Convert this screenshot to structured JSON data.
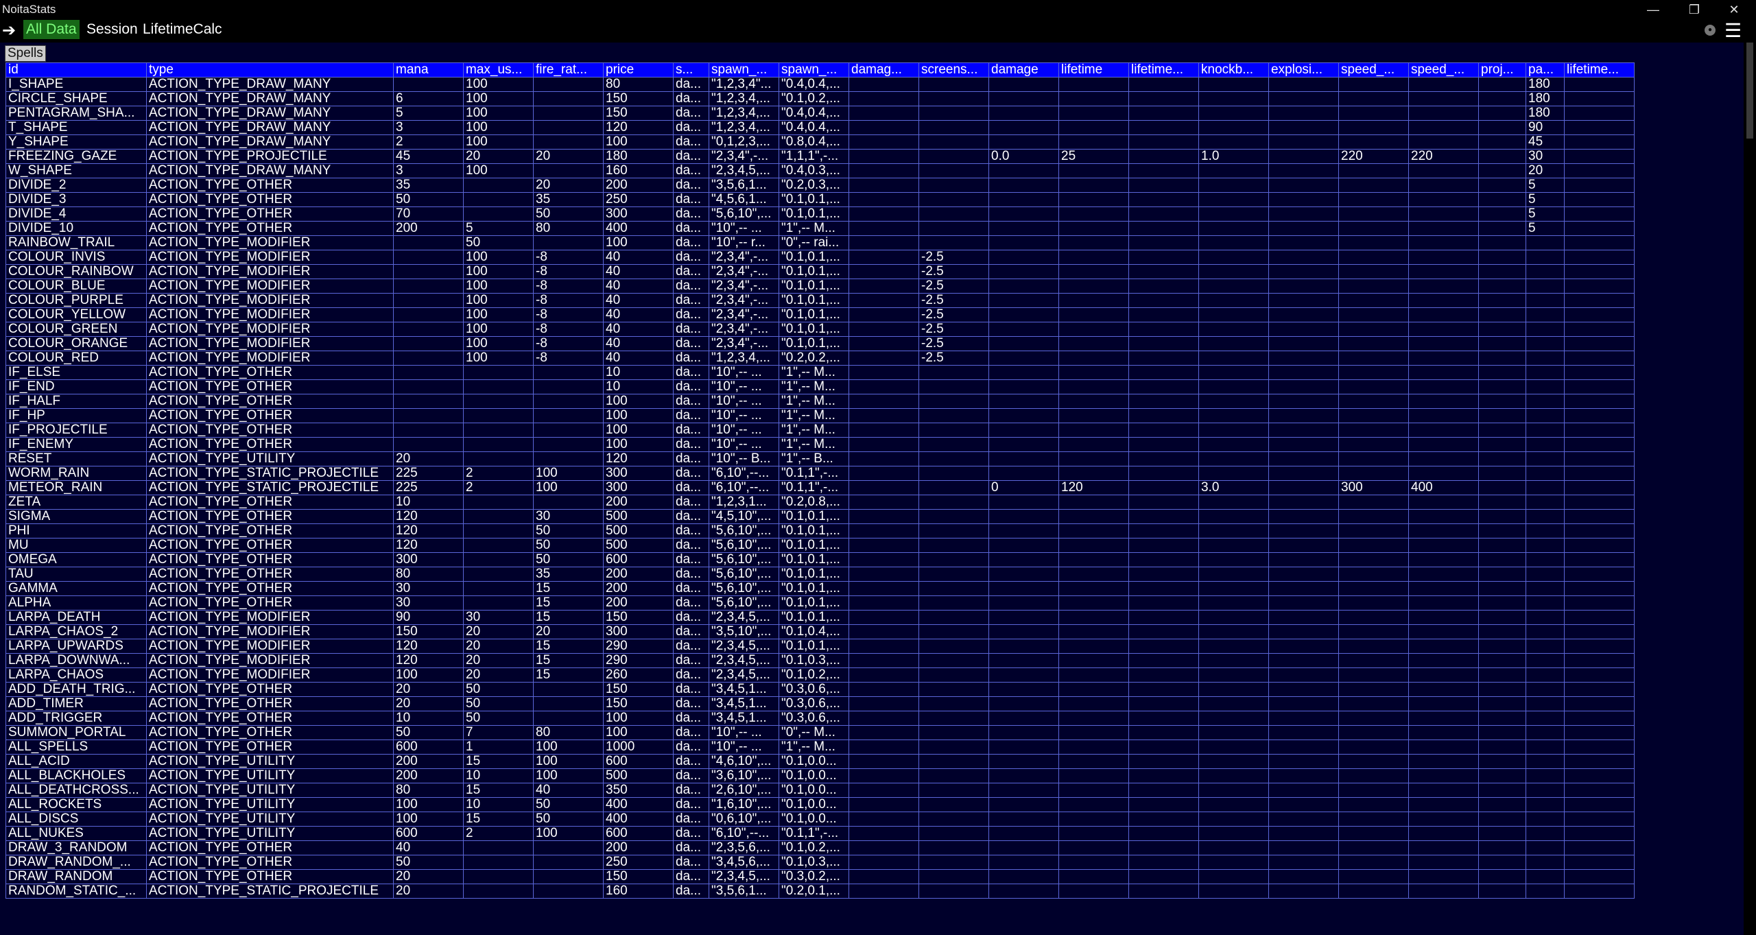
{
  "window": {
    "title": "NoitaStats"
  },
  "toolbar": {
    "tab_all": "All Data",
    "tab_session": "Session",
    "tab_lifetime": "LifetimeCalc"
  },
  "table_title": "Spells",
  "columns": [
    "id",
    "type",
    "mana",
    "max_us...",
    "fire_rat...",
    "price",
    "s...",
    "spawn_...",
    "spawn_...",
    "damag...",
    "screens...",
    "damage",
    "lifetime",
    "lifetime...",
    "knockb...",
    "explosi...",
    "speed_...",
    "speed_...",
    "proj...",
    "pa...",
    "lifetime..."
  ],
  "rows": [
    [
      "I_SHAPE",
      "ACTION_TYPE_DRAW_MANY",
      "",
      "100",
      "",
      "80",
      "da...",
      "\"1,2,3,4\"...",
      "\"0.4,0.4,...",
      "",
      "",
      "",
      "",
      "",
      "",
      "",
      "",
      "",
      "",
      "180",
      ""
    ],
    [
      "CIRCLE_SHAPE",
      "ACTION_TYPE_DRAW_MANY",
      "6",
      "100",
      "",
      "150",
      "da...",
      "\"1,2,3,4,...",
      "\"0.1,0.2,...",
      "",
      "",
      "",
      "",
      "",
      "",
      "",
      "",
      "",
      "",
      "180",
      ""
    ],
    [
      "PENTAGRAM_SHA...",
      "ACTION_TYPE_DRAW_MANY",
      "5",
      "100",
      "",
      "150",
      "da...",
      "\"1,2,3,4,...",
      "\"0.4,0.4,...",
      "",
      "",
      "",
      "",
      "",
      "",
      "",
      "",
      "",
      "",
      "180",
      ""
    ],
    [
      "T_SHAPE",
      "ACTION_TYPE_DRAW_MANY",
      "3",
      "100",
      "",
      "120",
      "da...",
      "\"1,2,3,4,...",
      "\"0.4,0.4,...",
      "",
      "",
      "",
      "",
      "",
      "",
      "",
      "",
      "",
      "",
      "90",
      ""
    ],
    [
      "Y_SHAPE",
      "ACTION_TYPE_DRAW_MANY",
      "2",
      "100",
      "",
      "100",
      "da...",
      "\"0,1,2,3,...",
      "\"0.8,0.4,...",
      "",
      "",
      "",
      "",
      "",
      "",
      "",
      "",
      "",
      "",
      "45",
      ""
    ],
    [
      "FREEZING_GAZE",
      "ACTION_TYPE_PROJECTILE",
      "45",
      "20",
      "20",
      "180",
      "da...",
      "\"2,3,4\",-...",
      "\"1,1,1\",-...",
      "",
      "",
      "0.0",
      "25",
      "",
      "1.0",
      "",
      "220",
      "220",
      "",
      "30",
      ""
    ],
    [
      "W_SHAPE",
      "ACTION_TYPE_DRAW_MANY",
      "3",
      "100",
      "",
      "160",
      "da...",
      "\"2,3,4,5,...",
      "\"0.4,0.3,...",
      "",
      "",
      "",
      "",
      "",
      "",
      "",
      "",
      "",
      "",
      "20",
      ""
    ],
    [
      "DIVIDE_2",
      "ACTION_TYPE_OTHER",
      "35",
      "",
      "20",
      "200",
      "da...",
      "\"3,5,6,1...",
      "\"0.2,0.3,...",
      "",
      "",
      "",
      "",
      "",
      "",
      "",
      "",
      "",
      "",
      "5",
      ""
    ],
    [
      "DIVIDE_3",
      "ACTION_TYPE_OTHER",
      "50",
      "",
      "35",
      "250",
      "da...",
      "\"4,5,6,1...",
      "\"0.1,0.1,...",
      "",
      "",
      "",
      "",
      "",
      "",
      "",
      "",
      "",
      "",
      "5",
      ""
    ],
    [
      "DIVIDE_4",
      "ACTION_TYPE_OTHER",
      "70",
      "",
      "50",
      "300",
      "da...",
      "\"5,6,10\",...",
      "\"0.1,0.1,...",
      "",
      "",
      "",
      "",
      "",
      "",
      "",
      "",
      "",
      "",
      "5",
      ""
    ],
    [
      "DIVIDE_10",
      "ACTION_TYPE_OTHER",
      "200",
      "5",
      "80",
      "400",
      "da...",
      "\"10\",-- ...",
      "\"1\",-- M...",
      "",
      "",
      "",
      "",
      "",
      "",
      "",
      "",
      "",
      "",
      "5",
      ""
    ],
    [
      "RAINBOW_TRAIL",
      "ACTION_TYPE_MODIFIER",
      "",
      "50",
      "",
      "100",
      "da...",
      "\"10\",-- r...",
      "\"0\",-- rai...",
      "",
      "",
      "",
      "",
      "",
      "",
      "",
      "",
      "",
      "",
      "",
      ""
    ],
    [
      "COLOUR_INVIS",
      "ACTION_TYPE_MODIFIER",
      "",
      "100",
      "-8",
      "40",
      "da...",
      "\"2,3,4\",-...",
      "\"0.1,0.1,...",
      "",
      "-2.5",
      "",
      "",
      "",
      "",
      "",
      "",
      "",
      "",
      "",
      ""
    ],
    [
      "COLOUR_RAINBOW",
      "ACTION_TYPE_MODIFIER",
      "",
      "100",
      "-8",
      "40",
      "da...",
      "\"2,3,4\",-...",
      "\"0.1,0.1,...",
      "",
      "-2.5",
      "",
      "",
      "",
      "",
      "",
      "",
      "",
      "",
      "",
      ""
    ],
    [
      "COLOUR_BLUE",
      "ACTION_TYPE_MODIFIER",
      "",
      "100",
      "-8",
      "40",
      "da...",
      "\"2,3,4\",-...",
      "\"0.1,0.1,...",
      "",
      "-2.5",
      "",
      "",
      "",
      "",
      "",
      "",
      "",
      "",
      "",
      ""
    ],
    [
      "COLOUR_PURPLE",
      "ACTION_TYPE_MODIFIER",
      "",
      "100",
      "-8",
      "40",
      "da...",
      "\"2,3,4\",-...",
      "\"0.1,0.1,...",
      "",
      "-2.5",
      "",
      "",
      "",
      "",
      "",
      "",
      "",
      "",
      "",
      ""
    ],
    [
      "COLOUR_YELLOW",
      "ACTION_TYPE_MODIFIER",
      "",
      "100",
      "-8",
      "40",
      "da...",
      "\"2,3,4\",-...",
      "\"0.1,0.1,...",
      "",
      "-2.5",
      "",
      "",
      "",
      "",
      "",
      "",
      "",
      "",
      "",
      ""
    ],
    [
      "COLOUR_GREEN",
      "ACTION_TYPE_MODIFIER",
      "",
      "100",
      "-8",
      "40",
      "da...",
      "\"2,3,4\",-...",
      "\"0.1,0.1,...",
      "",
      "-2.5",
      "",
      "",
      "",
      "",
      "",
      "",
      "",
      "",
      "",
      ""
    ],
    [
      "COLOUR_ORANGE",
      "ACTION_TYPE_MODIFIER",
      "",
      "100",
      "-8",
      "40",
      "da...",
      "\"2,3,4\",-...",
      "\"0.1,0.1,...",
      "",
      "-2.5",
      "",
      "",
      "",
      "",
      "",
      "",
      "",
      "",
      "",
      ""
    ],
    [
      "COLOUR_RED",
      "ACTION_TYPE_MODIFIER",
      "",
      "100",
      "-8",
      "40",
      "da...",
      "\"1,2,3,4,...",
      "\"0.2,0.2,...",
      "",
      "-2.5",
      "",
      "",
      "",
      "",
      "",
      "",
      "",
      "",
      "",
      ""
    ],
    [
      "IF_ELSE",
      "ACTION_TYPE_OTHER",
      "",
      "",
      "",
      "10",
      "da...",
      "\"10\",-- ...",
      "\"1\",-- M...",
      "",
      "",
      "",
      "",
      "",
      "",
      "",
      "",
      "",
      "",
      "",
      ""
    ],
    [
      "IF_END",
      "ACTION_TYPE_OTHER",
      "",
      "",
      "",
      "10",
      "da...",
      "\"10\",-- ...",
      "\"1\",-- M...",
      "",
      "",
      "",
      "",
      "",
      "",
      "",
      "",
      "",
      "",
      "",
      ""
    ],
    [
      "IF_HALF",
      "ACTION_TYPE_OTHER",
      "",
      "",
      "",
      "100",
      "da...",
      "\"10\",-- ...",
      "\"1\",-- M...",
      "",
      "",
      "",
      "",
      "",
      "",
      "",
      "",
      "",
      "",
      "",
      ""
    ],
    [
      "IF_HP",
      "ACTION_TYPE_OTHER",
      "",
      "",
      "",
      "100",
      "da...",
      "\"10\",-- ...",
      "\"1\",-- M...",
      "",
      "",
      "",
      "",
      "",
      "",
      "",
      "",
      "",
      "",
      "",
      ""
    ],
    [
      "IF_PROJECTILE",
      "ACTION_TYPE_OTHER",
      "",
      "",
      "",
      "100",
      "da...",
      "\"10\",-- ...",
      "\"1\",-- M...",
      "",
      "",
      "",
      "",
      "",
      "",
      "",
      "",
      "",
      "",
      "",
      ""
    ],
    [
      "IF_ENEMY",
      "ACTION_TYPE_OTHER",
      "",
      "",
      "",
      "100",
      "da...",
      "\"10\",-- ...",
      "\"1\",-- M...",
      "",
      "",
      "",
      "",
      "",
      "",
      "",
      "",
      "",
      "",
      "",
      ""
    ],
    [
      "RESET",
      "ACTION_TYPE_UTILITY",
      "20",
      "",
      "",
      "120",
      "da...",
      "\"10\",-- B...",
      "\"1\",-- B...",
      "",
      "",
      "",
      "",
      "",
      "",
      "",
      "",
      "",
      "",
      "",
      ""
    ],
    [
      "WORM_RAIN",
      "ACTION_TYPE_STATIC_PROJECTILE",
      "225",
      "2",
      "100",
      "300",
      "da...",
      "\"6,10\",--...",
      "\"0.1,1\",-...",
      "",
      "",
      "",
      "",
      "",
      "",
      "",
      "",
      "",
      "",
      "",
      ""
    ],
    [
      "METEOR_RAIN",
      "ACTION_TYPE_STATIC_PROJECTILE",
      "225",
      "2",
      "100",
      "300",
      "da...",
      "\"6,10\",--...",
      "\"0.1,1\",-...",
      "",
      "",
      "0",
      "120",
      "",
      "3.0",
      "",
      "300",
      "400",
      "",
      "",
      ""
    ],
    [
      "ZETA",
      "ACTION_TYPE_OTHER",
      "10",
      "",
      "",
      "200",
      "da...",
      "\"1,2,3,1...",
      "\"0.2,0.8,...",
      "",
      "",
      "",
      "",
      "",
      "",
      "",
      "",
      "",
      "",
      "",
      ""
    ],
    [
      "SIGMA",
      "ACTION_TYPE_OTHER",
      "120",
      "",
      "30",
      "500",
      "da...",
      "\"4,5,10\",...",
      "\"0.1,0.1,...",
      "",
      "",
      "",
      "",
      "",
      "",
      "",
      "",
      "",
      "",
      "",
      ""
    ],
    [
      "PHI",
      "ACTION_TYPE_OTHER",
      "120",
      "",
      "50",
      "500",
      "da...",
      "\"5,6,10\",...",
      "\"0.1,0.1,...",
      "",
      "",
      "",
      "",
      "",
      "",
      "",
      "",
      "",
      "",
      "",
      ""
    ],
    [
      "MU",
      "ACTION_TYPE_OTHER",
      "120",
      "",
      "50",
      "500",
      "da...",
      "\"5,6,10\",...",
      "\"0.1,0.1,...",
      "",
      "",
      "",
      "",
      "",
      "",
      "",
      "",
      "",
      "",
      "",
      ""
    ],
    [
      "OMEGA",
      "ACTION_TYPE_OTHER",
      "300",
      "",
      "50",
      "600",
      "da...",
      "\"5,6,10\",...",
      "\"0.1,0.1,...",
      "",
      "",
      "",
      "",
      "",
      "",
      "",
      "",
      "",
      "",
      "",
      ""
    ],
    [
      "TAU",
      "ACTION_TYPE_OTHER",
      "80",
      "",
      "35",
      "200",
      "da...",
      "\"5,6,10\",...",
      "\"0.1,0.1,...",
      "",
      "",
      "",
      "",
      "",
      "",
      "",
      "",
      "",
      "",
      "",
      ""
    ],
    [
      "GAMMA",
      "ACTION_TYPE_OTHER",
      "30",
      "",
      "15",
      "200",
      "da...",
      "\"5,6,10\",...",
      "\"0.1,0.1,...",
      "",
      "",
      "",
      "",
      "",
      "",
      "",
      "",
      "",
      "",
      "",
      ""
    ],
    [
      "ALPHA",
      "ACTION_TYPE_OTHER",
      "30",
      "",
      "15",
      "200",
      "da...",
      "\"5,6,10\",...",
      "\"0.1,0.1,...",
      "",
      "",
      "",
      "",
      "",
      "",
      "",
      "",
      "",
      "",
      "",
      ""
    ],
    [
      "LARPA_DEATH",
      "ACTION_TYPE_MODIFIER",
      "90",
      "30",
      "15",
      "150",
      "da...",
      "\"2,3,4,5,...",
      "\"0.1,0.1,...",
      "",
      "",
      "",
      "",
      "",
      "",
      "",
      "",
      "",
      "",
      "",
      ""
    ],
    [
      "LARPA_CHAOS_2",
      "ACTION_TYPE_MODIFIER",
      "150",
      "20",
      "20",
      "300",
      "da...",
      "\"3,5,10\",...",
      "\"0.1,0.4,...",
      "",
      "",
      "",
      "",
      "",
      "",
      "",
      "",
      "",
      "",
      "",
      ""
    ],
    [
      "LARPA_UPWARDS",
      "ACTION_TYPE_MODIFIER",
      "120",
      "20",
      "15",
      "290",
      "da...",
      "\"2,3,4,5,...",
      "\"0.1,0.1,...",
      "",
      "",
      "",
      "",
      "",
      "",
      "",
      "",
      "",
      "",
      "",
      ""
    ],
    [
      "LARPA_DOWNWA...",
      "ACTION_TYPE_MODIFIER",
      "120",
      "20",
      "15",
      "290",
      "da...",
      "\"2,3,4,5,...",
      "\"0.1,0.3,...",
      "",
      "",
      "",
      "",
      "",
      "",
      "",
      "",
      "",
      "",
      "",
      ""
    ],
    [
      "LARPA_CHAOS",
      "ACTION_TYPE_MODIFIER",
      "100",
      "20",
      "15",
      "260",
      "da...",
      "\"2,3,4,5,...",
      "\"0.1,0.2,...",
      "",
      "",
      "",
      "",
      "",
      "",
      "",
      "",
      "",
      "",
      "",
      ""
    ],
    [
      "ADD_DEATH_TRIG...",
      "ACTION_TYPE_OTHER",
      "20",
      "50",
      "",
      "150",
      "da...",
      "\"3,4,5,1...",
      "\"0.3,0.6,...",
      "",
      "",
      "",
      "",
      "",
      "",
      "",
      "",
      "",
      "",
      "",
      ""
    ],
    [
      "ADD_TIMER",
      "ACTION_TYPE_OTHER",
      "20",
      "50",
      "",
      "150",
      "da...",
      "\"3,4,5,1...",
      "\"0.3,0.6,...",
      "",
      "",
      "",
      "",
      "",
      "",
      "",
      "",
      "",
      "",
      "",
      ""
    ],
    [
      "ADD_TRIGGER",
      "ACTION_TYPE_OTHER",
      "10",
      "50",
      "",
      "100",
      "da...",
      "\"3,4,5,1...",
      "\"0.3,0.6,...",
      "",
      "",
      "",
      "",
      "",
      "",
      "",
      "",
      "",
      "",
      "",
      ""
    ],
    [
      "SUMMON_PORTAL",
      "ACTION_TYPE_OTHER",
      "50",
      "7",
      "80",
      "100",
      "da...",
      "\"10\",-- ...",
      "\"0\",-- M...",
      "",
      "",
      "",
      "",
      "",
      "",
      "",
      "",
      "",
      "",
      "",
      ""
    ],
    [
      "ALL_SPELLS",
      "ACTION_TYPE_OTHER",
      "600",
      "1",
      "100",
      "1000",
      "da...",
      "\"10\",-- ...",
      "\"1\",-- M...",
      "",
      "",
      "",
      "",
      "",
      "",
      "",
      "",
      "",
      "",
      "",
      ""
    ],
    [
      "ALL_ACID",
      "ACTION_TYPE_UTILITY",
      "200",
      "15",
      "100",
      "600",
      "da...",
      "\"4,6,10\",...",
      "\"0.1,0.0...",
      "",
      "",
      "",
      "",
      "",
      "",
      "",
      "",
      "",
      "",
      "",
      ""
    ],
    [
      "ALL_BLACKHOLES",
      "ACTION_TYPE_UTILITY",
      "200",
      "10",
      "100",
      "500",
      "da...",
      "\"3,6,10\",...",
      "\"0.1,0.0...",
      "",
      "",
      "",
      "",
      "",
      "",
      "",
      "",
      "",
      "",
      "",
      ""
    ],
    [
      "ALL_DEATHCROSS...",
      "ACTION_TYPE_UTILITY",
      "80",
      "15",
      "40",
      "350",
      "da...",
      "\"2,6,10\",...",
      "\"0.1,0.0...",
      "",
      "",
      "",
      "",
      "",
      "",
      "",
      "",
      "",
      "",
      "",
      ""
    ],
    [
      "ALL_ROCKETS",
      "ACTION_TYPE_UTILITY",
      "100",
      "10",
      "50",
      "400",
      "da...",
      "\"1,6,10\",...",
      "\"0.1,0.0...",
      "",
      "",
      "",
      "",
      "",
      "",
      "",
      "",
      "",
      "",
      "",
      ""
    ],
    [
      "ALL_DISCS",
      "ACTION_TYPE_UTILITY",
      "100",
      "15",
      "50",
      "400",
      "da...",
      "\"0,6,10\",...",
      "\"0.1,0.0...",
      "",
      "",
      "",
      "",
      "",
      "",
      "",
      "",
      "",
      "",
      "",
      ""
    ],
    [
      "ALL_NUKES",
      "ACTION_TYPE_UTILITY",
      "600",
      "2",
      "100",
      "600",
      "da...",
      "\"6,10\",--...",
      "\"0.1,1\",-...",
      "",
      "",
      "",
      "",
      "",
      "",
      "",
      "",
      "",
      "",
      "",
      ""
    ],
    [
      "DRAW_3_RANDOM",
      "ACTION_TYPE_OTHER",
      "40",
      "",
      "",
      "200",
      "da...",
      "\"2,3,5,6,...",
      "\"0.1,0.2,...",
      "",
      "",
      "",
      "",
      "",
      "",
      "",
      "",
      "",
      "",
      "",
      ""
    ],
    [
      "DRAW_RANDOM_...",
      "ACTION_TYPE_OTHER",
      "50",
      "",
      "",
      "250",
      "da...",
      "\"3,4,5,6,...",
      "\"0.1,0.3,...",
      "",
      "",
      "",
      "",
      "",
      "",
      "",
      "",
      "",
      "",
      "",
      ""
    ],
    [
      "DRAW_RANDOM",
      "ACTION_TYPE_OTHER",
      "20",
      "",
      "",
      "150",
      "da...",
      "\"2,3,4,5,...",
      "\"0.3,0.2,...",
      "",
      "",
      "",
      "",
      "",
      "",
      "",
      "",
      "",
      "",
      "",
      ""
    ],
    [
      "RANDOM_STATIC_...",
      "ACTION_TYPE_STATIC_PROJECTILE",
      "20",
      "",
      "",
      "160",
      "da...",
      "\"3,5,6,1...",
      "\"0.2,0.1,...",
      "",
      "",
      "",
      "",
      "",
      "",
      "",
      "",
      "",
      "",
      "",
      ""
    ]
  ]
}
